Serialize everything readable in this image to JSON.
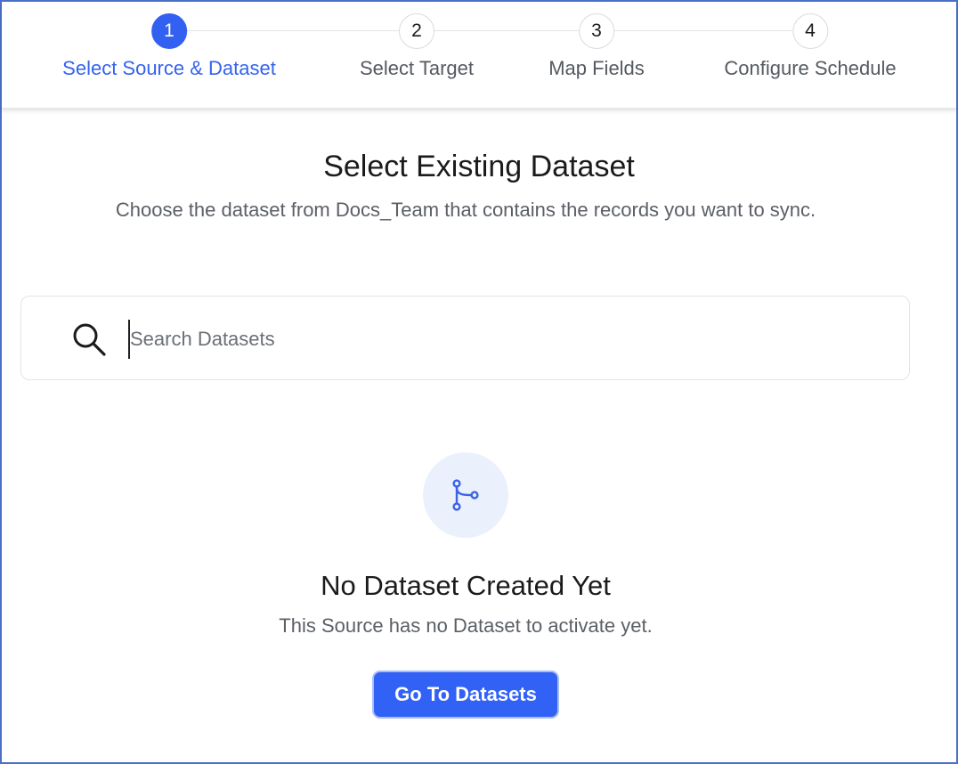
{
  "stepper": {
    "steps": [
      {
        "number": "1",
        "label": "Select Source & Dataset",
        "active": true
      },
      {
        "number": "2",
        "label": "Select Target",
        "active": false
      },
      {
        "number": "3",
        "label": "Map Fields",
        "active": false
      },
      {
        "number": "4",
        "label": "Configure Schedule",
        "active": false
      }
    ]
  },
  "main": {
    "title": "Select Existing Dataset",
    "subtitle": "Choose the dataset from Docs_Team that contains the records you want to sync."
  },
  "search": {
    "placeholder": "Search Datasets",
    "value": "",
    "icon": "search-icon"
  },
  "empty_state": {
    "icon": "dataset-branch-icon",
    "title": "No Dataset Created Yet",
    "text": "This Source has no Dataset to activate yet.",
    "button_label": "Go To Datasets"
  },
  "colors": {
    "accent": "#3260f0",
    "active_label": "#3463ee",
    "icon_bg": "#ebf0fd",
    "frame_border": "#4a6fc7"
  }
}
